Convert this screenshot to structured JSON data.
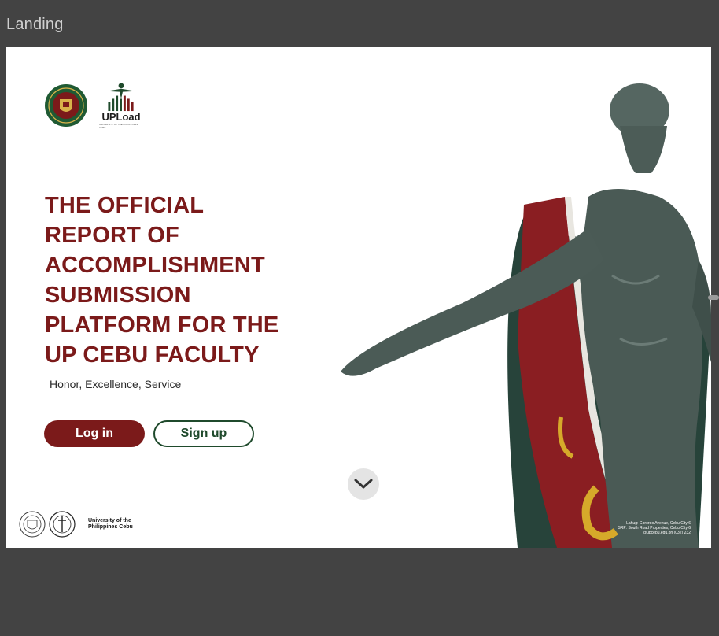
{
  "frame": {
    "label": "Landing"
  },
  "logos": {
    "upload_text": "UPLoad",
    "upload_subtext": "UNIVERSITY OF THE PHILIPPINES CEBU"
  },
  "hero": {
    "headline_lines": [
      "THE OFFICIAL",
      "REPORT OF",
      "ACCOMPLISHMENT",
      "SUBMISSION",
      "PLATFORM FOR THE",
      "UP CEBU FACULTY"
    ],
    "tagline": "Honor, Excellence, Service"
  },
  "buttons": {
    "login": "Log in",
    "signup": "Sign up"
  },
  "footer": {
    "university_name_lines": [
      "University of the",
      "Philippines Cebu"
    ],
    "address_lines": [
      "Lahug: Gorordo Avenue, Cebu City 6",
      "SRP: South Road Properties, Cebu City 6",
      "@upcebu.edu.ph (032) 232"
    ]
  },
  "icons": {
    "scroll": "chevron-down-icon",
    "seal": "up-seal-icon",
    "upload_logo": "upload-logo-icon",
    "statue": "oblation-statue-image"
  },
  "colors": {
    "maroon": "#7b1a1a",
    "green": "#1f4a2c",
    "background": "#434343"
  }
}
